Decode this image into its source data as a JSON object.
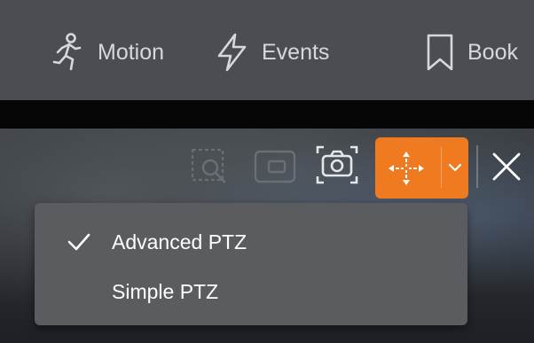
{
  "nav": {
    "items": [
      {
        "label": "Motion",
        "icon": "motion-icon"
      },
      {
        "label": "Events",
        "icon": "lightning-icon"
      },
      {
        "label": "Book",
        "icon": "bookmark-icon"
      }
    ]
  },
  "toolbar": {
    "icons": [
      "zoom-region-icon",
      "picture-in-picture-icon",
      "snapshot-icon",
      "ptz-move-icon",
      "chevron-down-icon",
      "close-icon"
    ],
    "ptz_accent": "#f07a1f"
  },
  "ptz_menu": {
    "items": [
      {
        "label": "Advanced PTZ",
        "checked": true
      },
      {
        "label": "Simple PTZ",
        "checked": false
      }
    ]
  }
}
